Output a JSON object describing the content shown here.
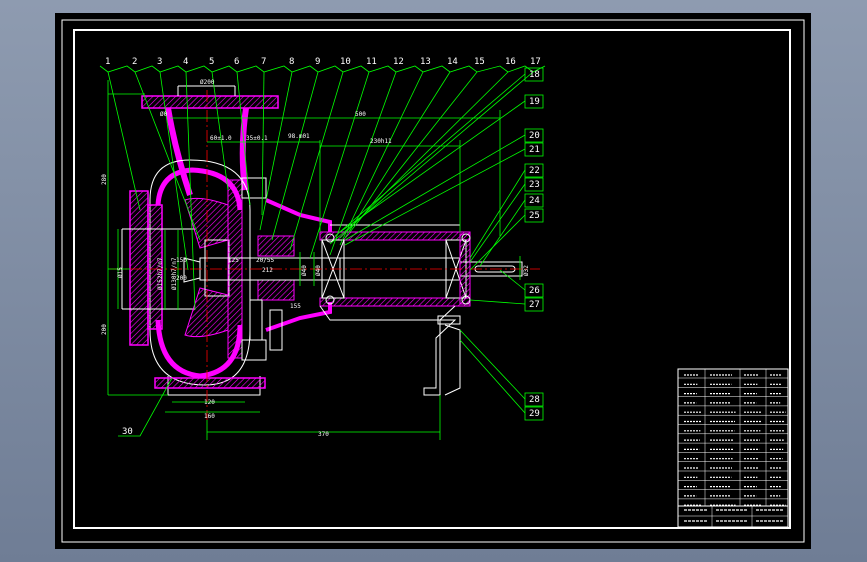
{
  "colors": {
    "background_outer": "#8e9bb0",
    "sheet": "#000000",
    "border": "#ffffff",
    "leader": "#00ff00",
    "section": "#ff00ff",
    "centerline": "#ff0000",
    "outline": "#ffffff"
  },
  "part_labels": [
    "1",
    "2",
    "3",
    "4",
    "5",
    "6",
    "7",
    "8",
    "9",
    "10",
    "11",
    "12",
    "13",
    "14",
    "15",
    "16",
    "17",
    "18",
    "19",
    "20",
    "21",
    "22",
    "23",
    "24",
    "25",
    "26",
    "27",
    "28",
    "29",
    "30"
  ],
  "dimensions": {
    "flange_dia": "Ø200",
    "d1": "Ø0",
    "d2": "60±1.0",
    "d3": "35±0.1",
    "d4": "98.m01",
    "d5": "500",
    "d6": "230h11",
    "h_top": "280",
    "h_bottom": "200",
    "d_left": "Ø15",
    "d_imp1": "Ø152h7/n7",
    "d_imp2": "Ø130h7/n7",
    "d_s1": "Ø40",
    "d_s2": "Ø40",
    "d_shaft": "Ø32",
    "base1": "120",
    "base2": "160",
    "base3": "370",
    "s1": "125",
    "s2": "20/55",
    "s3": "212",
    "s4": "155",
    "s5": "150",
    "s6": "200"
  }
}
